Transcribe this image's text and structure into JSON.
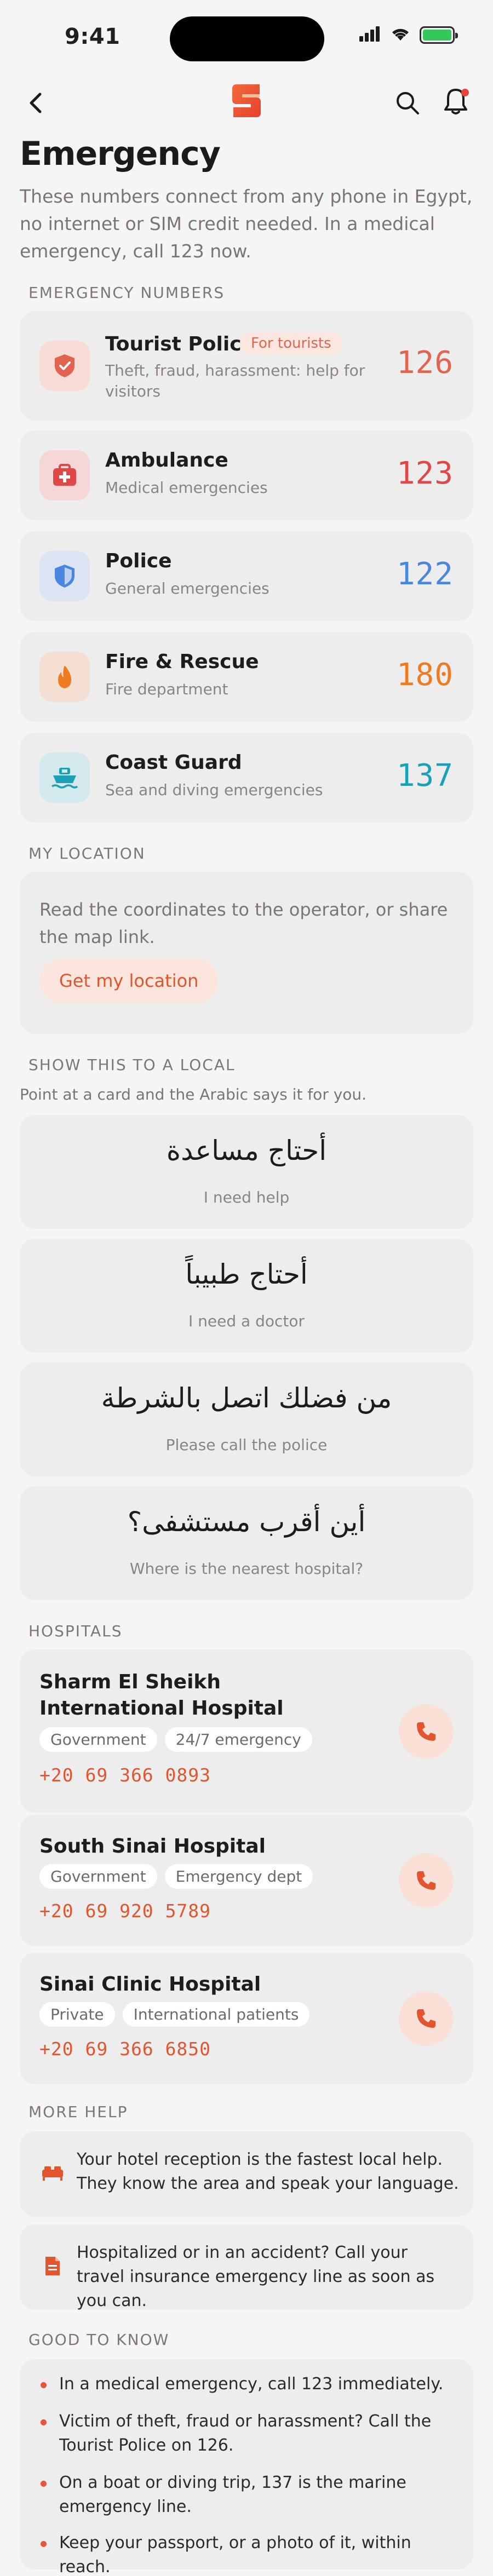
{
  "status": {
    "time": "9:41"
  },
  "page": {
    "title": "Emergency",
    "intro": "These numbers connect from any phone in Egypt, no internet or SIM credit needed. In a medical emergency, call 123 now."
  },
  "sections": {
    "numbers": "EMERGENCY NUMBERS",
    "location": "MY LOCATION",
    "show_local": "SHOW THIS TO A LOCAL",
    "show_local_sub": "Point at a card and the Arabic says it for you.",
    "hospitals": "HOSPITALS",
    "more_help": "MORE HELP",
    "good_to_know": "GOOD TO KNOW"
  },
  "emergency_numbers": [
    {
      "name": "Tourist Police",
      "badge": "For tourists",
      "desc": "Theft, fraud, harassment: help for visitors",
      "number": "126",
      "color": "#e2634f",
      "icon": "shield-icon",
      "icon_bg": "#f8dcd6"
    },
    {
      "name": "Ambulance",
      "desc": "Medical emergencies",
      "number": "123",
      "color": "#e04848",
      "icon": "first-aid-icon",
      "icon_bg": "#f6d6d7"
    },
    {
      "name": "Police",
      "desc": "General emergencies",
      "number": "122",
      "color": "#4a86df",
      "icon": "police-shield-icon",
      "icon_bg": "#dce4f4"
    },
    {
      "name": "Fire & Rescue",
      "desc": "Fire department",
      "number": "180",
      "color": "#ef7a1f",
      "icon": "flame-icon",
      "icon_bg": "#f5dfd2"
    },
    {
      "name": "Coast Guard",
      "desc": "Sea and diving emergencies",
      "number": "137",
      "color": "#1aa1b8",
      "icon": "boat-icon",
      "icon_bg": "#d4e9ee"
    }
  ],
  "location": {
    "text": "Read the coordinates to the operator, or share the map link.",
    "button": "Get my location"
  },
  "phrases": [
    {
      "ar": "أحتاج مساعدة",
      "en": "I need help"
    },
    {
      "ar": "أحتاج طبيباً",
      "en": "I need a doctor"
    },
    {
      "ar": "من فضلك اتصل بالشرطة",
      "en": "Please call the police"
    },
    {
      "ar": "أين أقرب مستشفى؟",
      "en": "Where is the nearest hospital?"
    }
  ],
  "hospitals": [
    {
      "name": "Sharm El Sheikh International Hospital",
      "tags": [
        "Government",
        "24/7 emergency"
      ],
      "phone": "+20 69 366 0893"
    },
    {
      "name": "South Sinai Hospital",
      "tags": [
        "Government",
        "Emergency dept"
      ],
      "phone": "+20 69 920 5789"
    },
    {
      "name": "Sinai Clinic Hospital",
      "tags": [
        "Private",
        "International patients"
      ],
      "phone": "+20 69 366 6850"
    }
  ],
  "more_help": [
    {
      "icon": "bed-icon",
      "text": "Your hotel reception is the fastest local help. They know the area and speak your language."
    },
    {
      "icon": "document-icon",
      "text": "Hospitalized or in an accident? Call your travel insurance emergency line as soon as you can."
    }
  ],
  "tips": [
    "In a medical emergency, call 123 immediately.",
    "Victim of theft, fraud or harassment? Call the Tourist Police on 126.",
    "On a boat or diving trip, 137 is the marine emergency line.",
    "Keep your passport, or a photo of it, within reach."
  ],
  "colors": {
    "accent": "#e2552e",
    "background": "#f6f5f5",
    "card": "#ededee"
  }
}
